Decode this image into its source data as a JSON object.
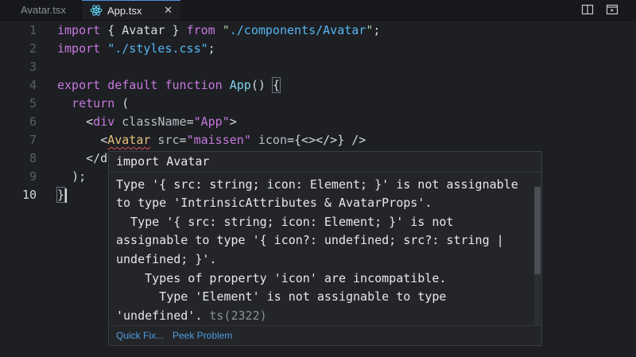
{
  "tabs": [
    {
      "label": "Avatar.tsx",
      "active": false
    },
    {
      "label": "App.tsx",
      "active": true
    }
  ],
  "toolbar": {
    "split_icon": "split-editor-icon",
    "preview_icon": "open-preview-icon"
  },
  "gutter": [
    "1",
    "2",
    "3",
    "4",
    "5",
    "6",
    "7",
    "8",
    "9",
    "10"
  ],
  "code": {
    "l1": {
      "kw1": "import",
      "p1": " { ",
      "id": "Avatar",
      "p2": " } ",
      "kw2": "from",
      "sp": " ",
      "q1": "\"",
      "path": "./components/Avatar",
      "q2": "\"",
      "end": ";"
    },
    "l2": {
      "kw": "import",
      "sp": " ",
      "str": "\"./styles.css\"",
      "end": ";"
    },
    "l4": {
      "kw1": "export",
      "kw2": "default",
      "kw3": "function",
      "fn": "App",
      "rest": "() ",
      "brace": "{"
    },
    "l5": {
      "kw": "return",
      "rest": " ("
    },
    "l6": {
      "open": "<",
      "tag": "div",
      "attr": " className",
      "eq": "=",
      "val": "\"App\"",
      "close": ">"
    },
    "l7": {
      "open": "<",
      "tag": "Avatar",
      "attr1": " src",
      "eq1": "=",
      "val1": "\"maissen\"",
      "attr2": " icon",
      "eq2": "=",
      "val2": "{<></>}",
      "close": " />"
    },
    "l8": {
      "text": "</d"
    },
    "l9": {
      "text": ");"
    },
    "l10": {
      "brace": "}"
    }
  },
  "hover": {
    "header": "import Avatar",
    "lines": [
      "Type '{ src: string; icon: Element; }' is not assignable",
      "to type 'IntrinsicAttributes & AvatarProps'.",
      "  Type '{ src: string; icon: Element; }' is not",
      "assignable to type '{ icon?: undefined; src?: string |",
      "undefined; }'.",
      "    Types of property 'icon' are incompatible.",
      "      Type 'Element' is not assignable to type",
      "'undefined'."
    ],
    "code": "ts(2322)",
    "actions": [
      "Quick Fix...",
      "Peek Problem"
    ]
  },
  "colors": {
    "accent": "#4f9de0",
    "error": "#e05252",
    "background": "#1d1f23"
  }
}
